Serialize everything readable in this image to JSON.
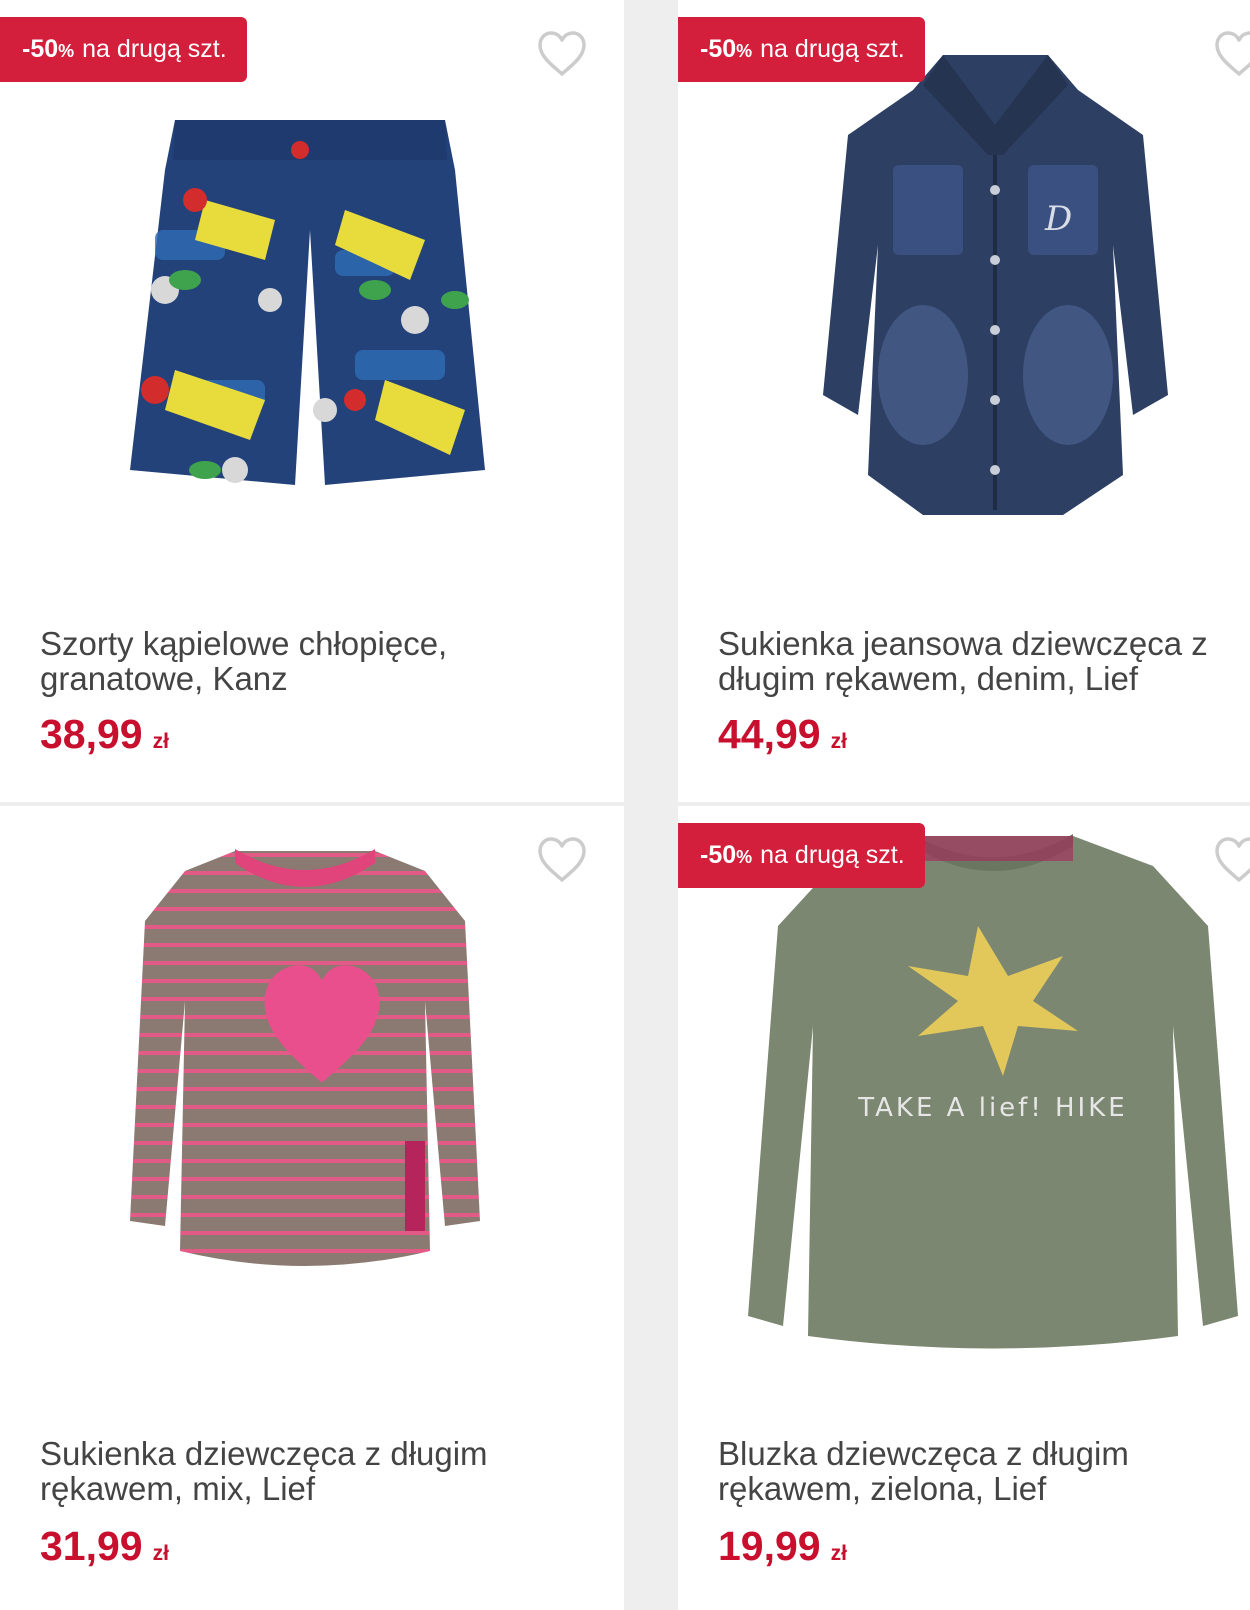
{
  "products": [
    {
      "badge_strong": "-50",
      "badge_pct": "%",
      "badge_rest": "na drugą szt.",
      "image_icon": "swim-shorts-image",
      "title": "Szorty kąpielowe chłopięce, granatowe, Kanz",
      "price": "38,99",
      "currency": "zł"
    },
    {
      "badge_strong": "-50",
      "badge_pct": "%",
      "badge_rest": "na drugą szt.",
      "image_icon": "denim-dress-image",
      "title": "Sukienka jeansowa dziewczęca z długim rękawem, denim, Lief",
      "price": "44,99",
      "currency": "zł"
    },
    {
      "image_icon": "striped-heart-dress-image",
      "title": "Sukienka dziewczęca z długim rękawem, mix, Lief",
      "price": "31,99",
      "currency": "zł"
    },
    {
      "badge_strong": "-50",
      "badge_pct": "%",
      "badge_rest": "na drugą szt.",
      "image_icon": "green-star-blouse-image",
      "image_print_text": "TAKE A lief! HIKE",
      "title": "Bluzka dziewczęca z długim rękawem, zielona, Lief",
      "price": "19,99",
      "currency": "zł"
    }
  ],
  "colors": {
    "badge": "#d31f3c",
    "price": "#c8102e",
    "title": "#444444",
    "heart_outline": "#cccccc",
    "background": "#eeeeee"
  }
}
